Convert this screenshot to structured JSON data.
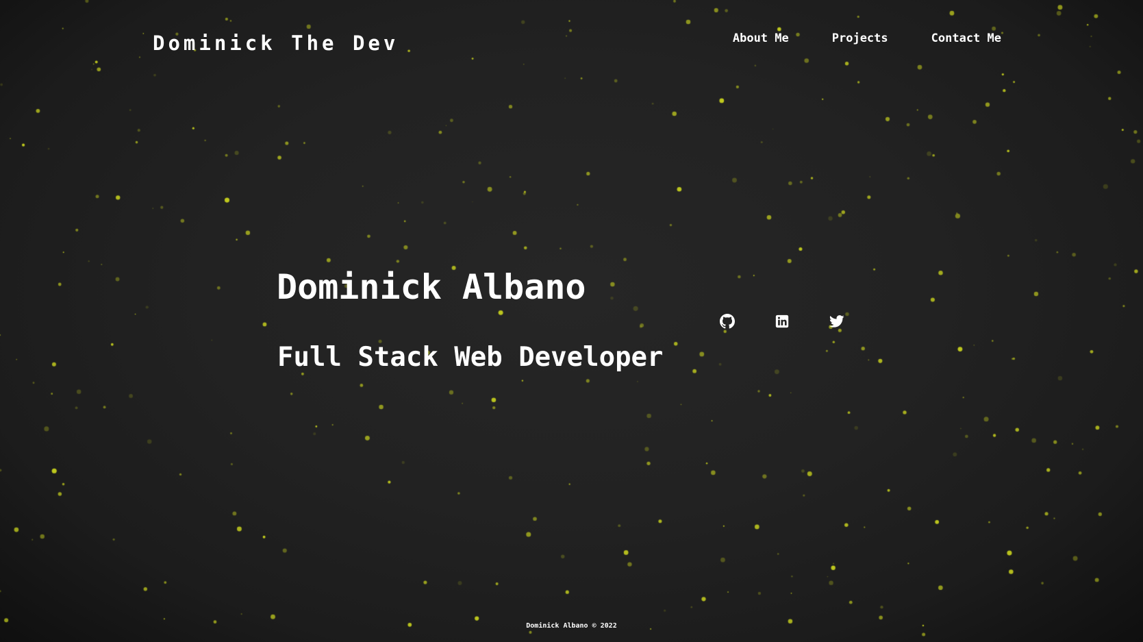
{
  "header": {
    "brand": "Dominick The Dev",
    "nav": [
      {
        "label": "About Me"
      },
      {
        "label": "Projects"
      },
      {
        "label": "Contact Me"
      }
    ]
  },
  "hero": {
    "name": "Dominick Albano",
    "title": "Full Stack Web Developer"
  },
  "social": [
    {
      "icon": "github-icon"
    },
    {
      "icon": "linkedin-icon"
    },
    {
      "icon": "twitter-icon"
    }
  ],
  "footer": {
    "text": "Dominick Albano © 2022"
  },
  "theme": {
    "background": "#222222",
    "particle_color": "#c8d21e",
    "text_color": "#ffffff"
  }
}
